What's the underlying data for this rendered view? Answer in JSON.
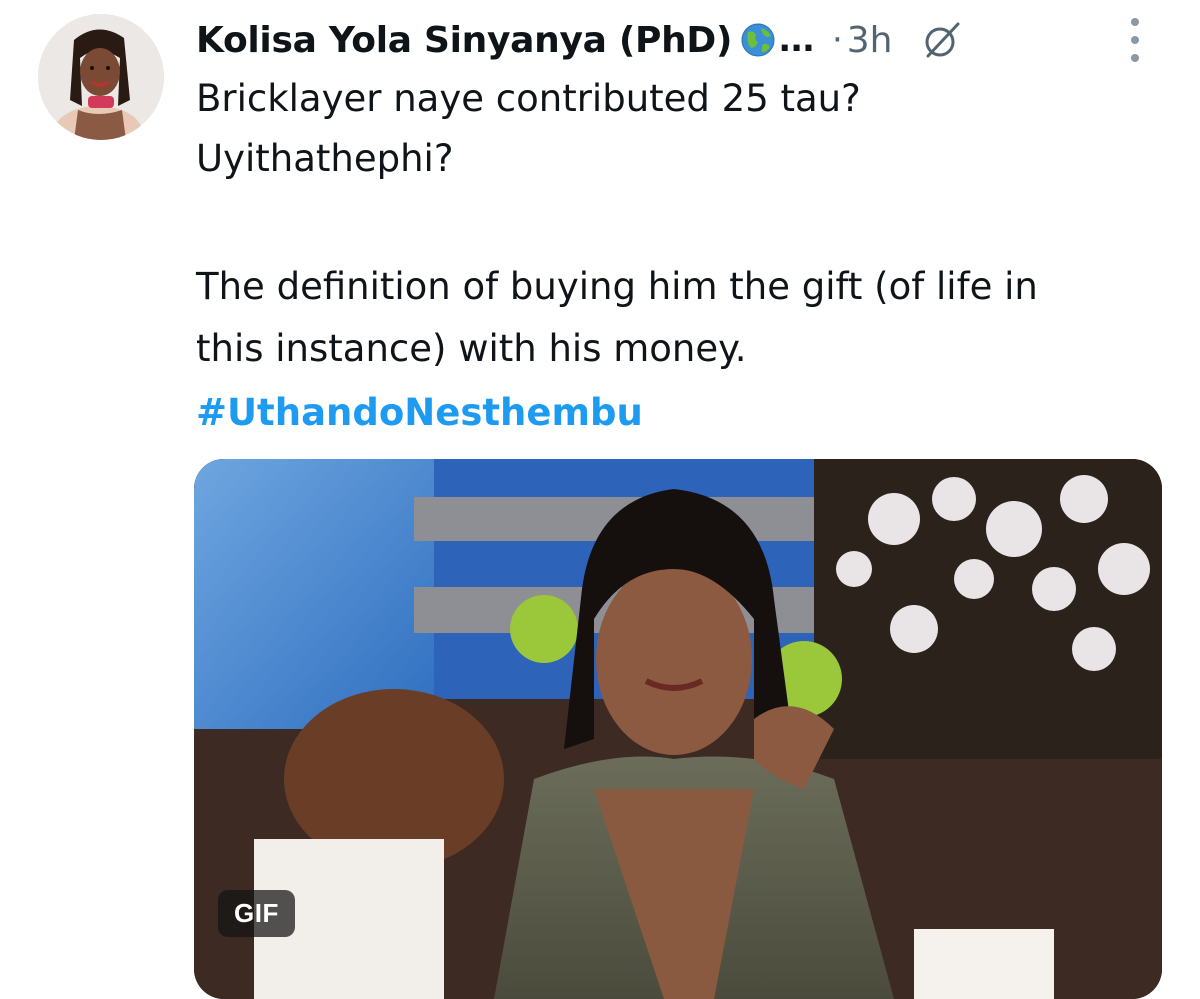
{
  "tweet": {
    "author": {
      "display_name": "Kolisa Yola Sinyanya (PhD)",
      "badge_icon": "globe-emoji",
      "truncation": "...",
      "avatar_icon": "profile-photo"
    },
    "separator": "·",
    "time_ago": "3h",
    "grok_icon": "grok-icon",
    "more_icon": "more-options-icon",
    "text": {
      "line1": "Bricklayer naye contributed 25 tau?",
      "line2": "Uyithathephi?",
      "line3": "The definition of buying him the gift (of life in",
      "line4": "this instance) with his money.",
      "hashtag": "#UthandoNesthembu"
    },
    "media": {
      "type_label": "GIF"
    }
  },
  "colors": {
    "link": "#1d9bf0",
    "secondary_text": "#536471",
    "primary_text": "#0f1419"
  }
}
